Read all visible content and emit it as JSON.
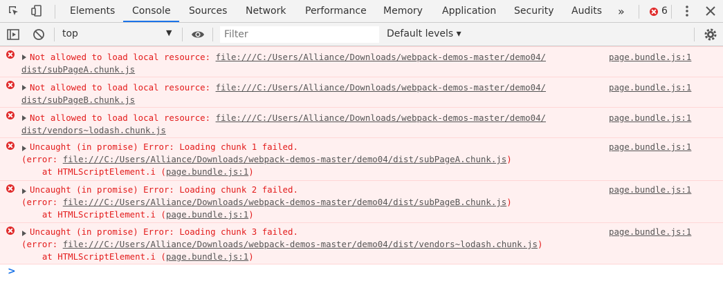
{
  "tabs": [
    {
      "label": "Elements"
    },
    {
      "label": "Console",
      "active": true
    },
    {
      "label": "Sources"
    },
    {
      "label": "Network"
    },
    {
      "label": "Performance"
    },
    {
      "label": "Memory"
    },
    {
      "label": "Application"
    },
    {
      "label": "Security"
    },
    {
      "label": "Audits"
    }
  ],
  "more_tabs_label": "»",
  "error_count": "6",
  "toolbar": {
    "context": "top",
    "filter_placeholder": "Filter",
    "levels": "Default levels ▾"
  },
  "colors": {
    "accent": "#1a73e8",
    "error_bg": "#fff0f0",
    "error_text": "#e31b1b"
  },
  "messages": [
    {
      "l1_prefix": "Not allowed to load local resource: ",
      "l1_link": "file:///C:/Users/Alliance/Downloads/webpack-demos-master/demo04/",
      "l2_link": "dist/subPageA.chunk.js",
      "source": "page.bundle.js:1"
    },
    {
      "l1_prefix": "Not allowed to load local resource: ",
      "l1_link": "file:///C:/Users/Alliance/Downloads/webpack-demos-master/demo04/",
      "l2_link": "dist/subPageB.chunk.js",
      "source": "page.bundle.js:1"
    },
    {
      "l1_prefix": "Not allowed to load local resource: ",
      "l1_link": "file:///C:/Users/Alliance/Downloads/webpack-demos-master/demo04/",
      "l2_link": "dist/vendors~lodash.chunk.js",
      "source": "page.bundle.js:1"
    },
    {
      "l1": "Uncaught (in promise) Error: Loading chunk 1 failed.",
      "l2_prefix": "(error: ",
      "l2_link": "file:///C:/Users/Alliance/Downloads/webpack-demos-master/demo04/dist/subPageA.chunk.js",
      "l2_suffix": ")",
      "l3_prefix": "    at HTMLScriptElement.i (",
      "l3_link": "page.bundle.js:1",
      "l3_suffix": ")",
      "source": "page.bundle.js:1"
    },
    {
      "l1": "Uncaught (in promise) Error: Loading chunk 2 failed.",
      "l2_prefix": "(error: ",
      "l2_link": "file:///C:/Users/Alliance/Downloads/webpack-demos-master/demo04/dist/subPageB.chunk.js",
      "l2_suffix": ")",
      "l3_prefix": "    at HTMLScriptElement.i (",
      "l3_link": "page.bundle.js:1",
      "l3_suffix": ")",
      "source": "page.bundle.js:1"
    },
    {
      "l1": "Uncaught (in promise) Error: Loading chunk 3 failed.",
      "l2_prefix": "(error: ",
      "l2_link": "file:///C:/Users/Alliance/Downloads/webpack-demos-master/demo04/dist/vendors~lodash.chunk.js",
      "l2_suffix": ")",
      "l3_prefix": "    at HTMLScriptElement.i (",
      "l3_link": "page.bundle.js:1",
      "l3_suffix": ")",
      "source": "page.bundle.js:1"
    }
  ],
  "prompt": ">"
}
